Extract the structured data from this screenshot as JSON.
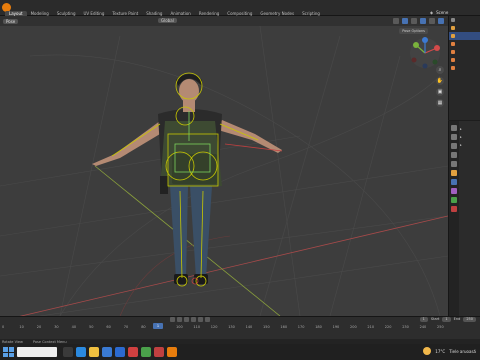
{
  "app": {
    "workspace_tabs": [
      "Layout",
      "Modeling",
      "Sculpting",
      "UV Editing",
      "Texture Paint",
      "Shading",
      "Animation",
      "Rendering",
      "Compositing",
      "Geometry Nodes",
      "Scripting"
    ],
    "active_tab": "Layout",
    "scene_label": "Scene"
  },
  "viewport": {
    "mode_label": "Pose",
    "orientation_label": "Global",
    "pose_options_label": "Pose Options"
  },
  "timeline": {
    "ruler_ticks": [
      "0",
      "10",
      "20",
      "30",
      "40",
      "50",
      "60",
      "70",
      "80",
      "90",
      "100",
      "110",
      "120",
      "130",
      "140",
      "150",
      "160",
      "170",
      "180",
      "190",
      "200",
      "210",
      "220",
      "230",
      "240",
      "250"
    ],
    "current_frame": "1",
    "start_label": "Start",
    "start_value": "1",
    "end_label": "End",
    "end_value": "250"
  },
  "statusbar": {
    "left_text": "Rotate View",
    "middle_text": "Pose Context Menu"
  },
  "taskbar": {
    "search_placeholder": "",
    "weather_temp": "17°C",
    "weather_text": "Tiele aruoasă"
  },
  "colors": {
    "accent": "#4772b3",
    "brand": "#e87d0d",
    "bone_yellow": "#c8c800",
    "bone_green": "#7ad35c"
  }
}
